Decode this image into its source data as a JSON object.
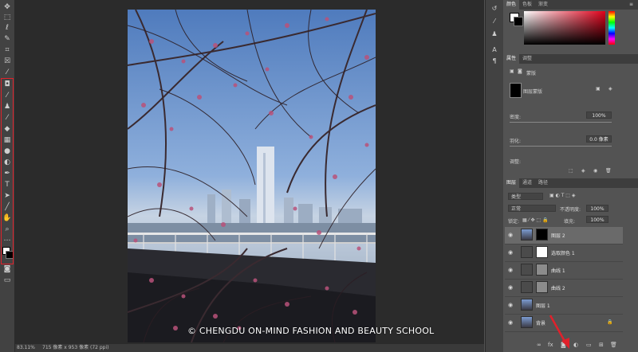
{
  "status_bar": {
    "zoom": "83.11%",
    "doc_info": "715 像素 x 953 像素 (72 ppi)"
  },
  "watermark": "© CHENGDU ON-MIND FASHION AND BEAUTY SCHOOL",
  "color_panel": {
    "tabs": [
      "颜色",
      "色板",
      "渐变"
    ]
  },
  "properties_panel": {
    "tabs": [
      "属性",
      "调整"
    ],
    "section_label": "蒙版",
    "layer_mask_label": "图层蒙版",
    "density_label": "密度:",
    "density_value": "100%",
    "feather_label": "羽化:",
    "feather_value": "0.0 像素",
    "adjust_label": "调整:"
  },
  "layers_panel": {
    "tabs": [
      "图层",
      "通道",
      "路径"
    ],
    "filter_kind": "类型",
    "blend_mode": "正常",
    "opacity_label": "不透明度:",
    "opacity_value": "100%",
    "lock_label": "锁定:",
    "fill_label": "填充:",
    "fill_value": "100%",
    "layers": [
      {
        "name": "图层 2",
        "selected": true
      },
      {
        "name": "选取颜色 1",
        "selected": false
      },
      {
        "name": "曲线 1",
        "selected": false
      },
      {
        "name": "曲线 2",
        "selected": false
      },
      {
        "name": "图层 1",
        "selected": false
      },
      {
        "name": "背景",
        "selected": false
      }
    ],
    "bottom_icons": [
      "link-icon",
      "fx-icon",
      "mask-icon",
      "adjustment-icon",
      "folder-icon",
      "new-layer-icon",
      "trash-icon"
    ]
  },
  "colors": {
    "highlight_red": "#e0212b",
    "selected_layer": "#6a6a6a"
  }
}
